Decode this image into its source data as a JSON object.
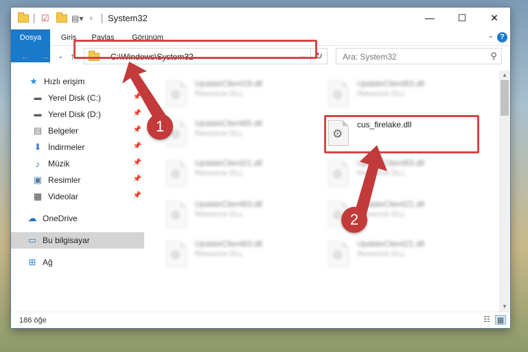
{
  "window": {
    "title": "System32",
    "controls": {
      "minimize": "—",
      "maximize": "☐",
      "close": "✕"
    }
  },
  "ribbon": {
    "tabs": [
      "Dosya",
      "Giriş",
      "Paylaş",
      "Görünüm"
    ],
    "help": "?"
  },
  "address": {
    "path": "C:\\Windows\\System32",
    "search_placeholder": "Ara: System32"
  },
  "sidebar": {
    "items": [
      {
        "label": "Hızlı erişim",
        "icon": "star-icon",
        "pinned": false
      },
      {
        "label": "Yerel Disk (C:)",
        "icon": "drive-icon",
        "pinned": true
      },
      {
        "label": "Yerel Disk (D:)",
        "icon": "drive-icon",
        "pinned": true
      },
      {
        "label": "Belgeler",
        "icon": "documents-icon",
        "pinned": true
      },
      {
        "label": "İndirmeler",
        "icon": "download-icon",
        "pinned": true
      },
      {
        "label": "Müzik",
        "icon": "music-icon",
        "pinned": true
      },
      {
        "label": "Resimler",
        "icon": "pictures-icon",
        "pinned": true
      },
      {
        "label": "Videolar",
        "icon": "videos-icon",
        "pinned": true
      },
      {
        "label": "OneDrive",
        "icon": "cloud-icon",
        "pinned": false
      },
      {
        "label": "Bu bilgisayar",
        "icon": "computer-icon",
        "pinned": false,
        "selected": true
      },
      {
        "label": "Ağ",
        "icon": "network-icon",
        "pinned": false
      }
    ]
  },
  "files": [
    {
      "name": "UpdateClient19.dll",
      "type": "Resource DLL",
      "blurred": true
    },
    {
      "name": "UpdateClient63.dll",
      "type": "Resource DLL",
      "blurred": true
    },
    {
      "name": "UpdateClient65.dll",
      "type": "Resource DLL",
      "blurred": true
    },
    {
      "name": "cus_firelake.dll",
      "type": "",
      "blurred": false,
      "highlighted": true
    },
    {
      "name": "UpdateClient21.dll",
      "type": "Resource DLL",
      "blurred": true
    },
    {
      "name": "UpdateClient63.dll",
      "type": "Resource DLL",
      "blurred": true
    },
    {
      "name": "UpdateClient63.dll",
      "type": "Resource DLL",
      "blurred": true
    },
    {
      "name": "UpdateClient21.dll",
      "type": "Resource DLL",
      "blurred": true
    },
    {
      "name": "UpdateClient63.dll",
      "type": "Resource DLL",
      "blurred": true
    },
    {
      "name": "UpdateClient21.dll",
      "type": "Resource DLL",
      "blurred": true
    }
  ],
  "status": {
    "count": "186 öğe"
  },
  "callouts": [
    "1",
    "2"
  ],
  "colors": {
    "accent": "#1979ca",
    "highlight": "#d64545",
    "callout": "#c33a3a"
  }
}
